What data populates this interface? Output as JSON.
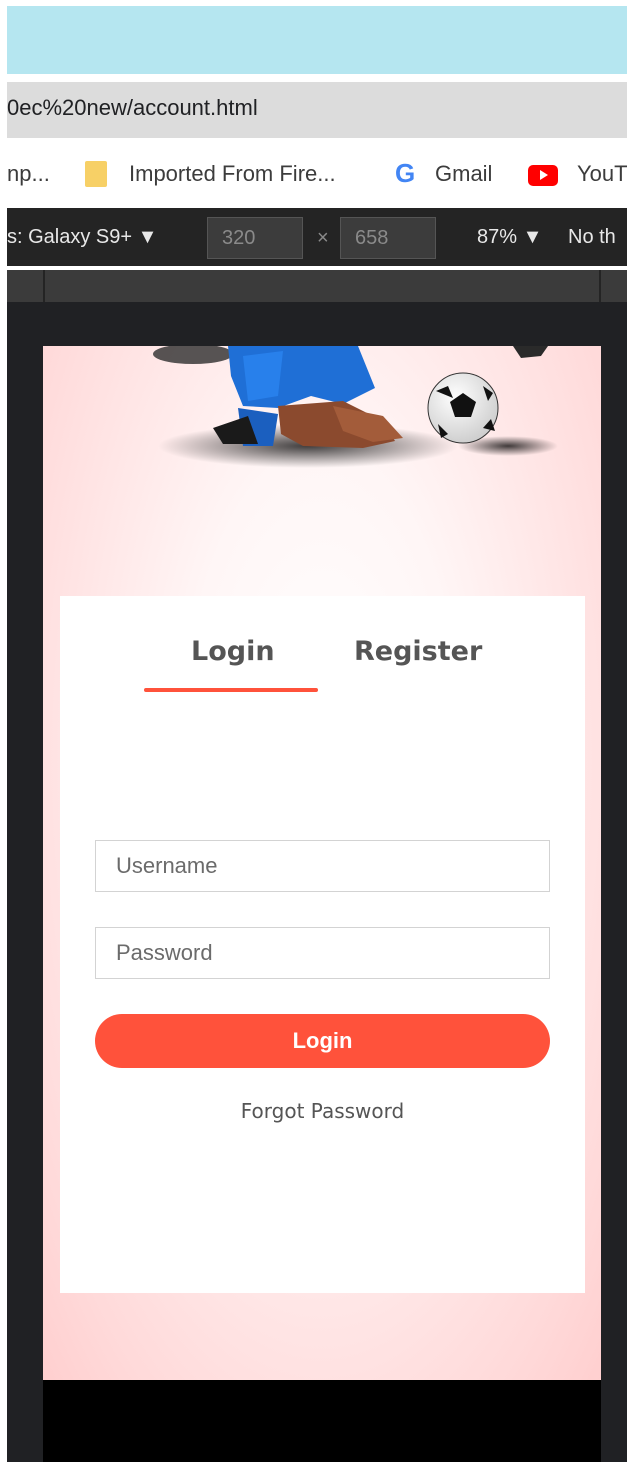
{
  "browser": {
    "url": "0ec%20new/account.html",
    "bookmarks": [
      {
        "label": "np...",
        "icon": "bookmark-folder-icon"
      },
      {
        "label": "Imported From Fire...",
        "icon": "folder-icon"
      },
      {
        "label": "Gmail",
        "icon": "google-icon"
      },
      {
        "label": "YouT",
        "icon": "youtube-icon"
      }
    ]
  },
  "devtools": {
    "device": "s: Galaxy S9+ ▼",
    "width": "320",
    "times": "×",
    "height": "658",
    "zoom": "87% ▼",
    "throttle": "No th"
  },
  "page": {
    "tabs": {
      "login": "Login",
      "register": "Register"
    },
    "form": {
      "username_placeholder": "Username",
      "password_placeholder": "Password",
      "submit_label": "Login",
      "forgot_label": "Forgot Password"
    },
    "colors": {
      "accent": "#ff523b",
      "background_tint": "#ffd9d9"
    }
  }
}
